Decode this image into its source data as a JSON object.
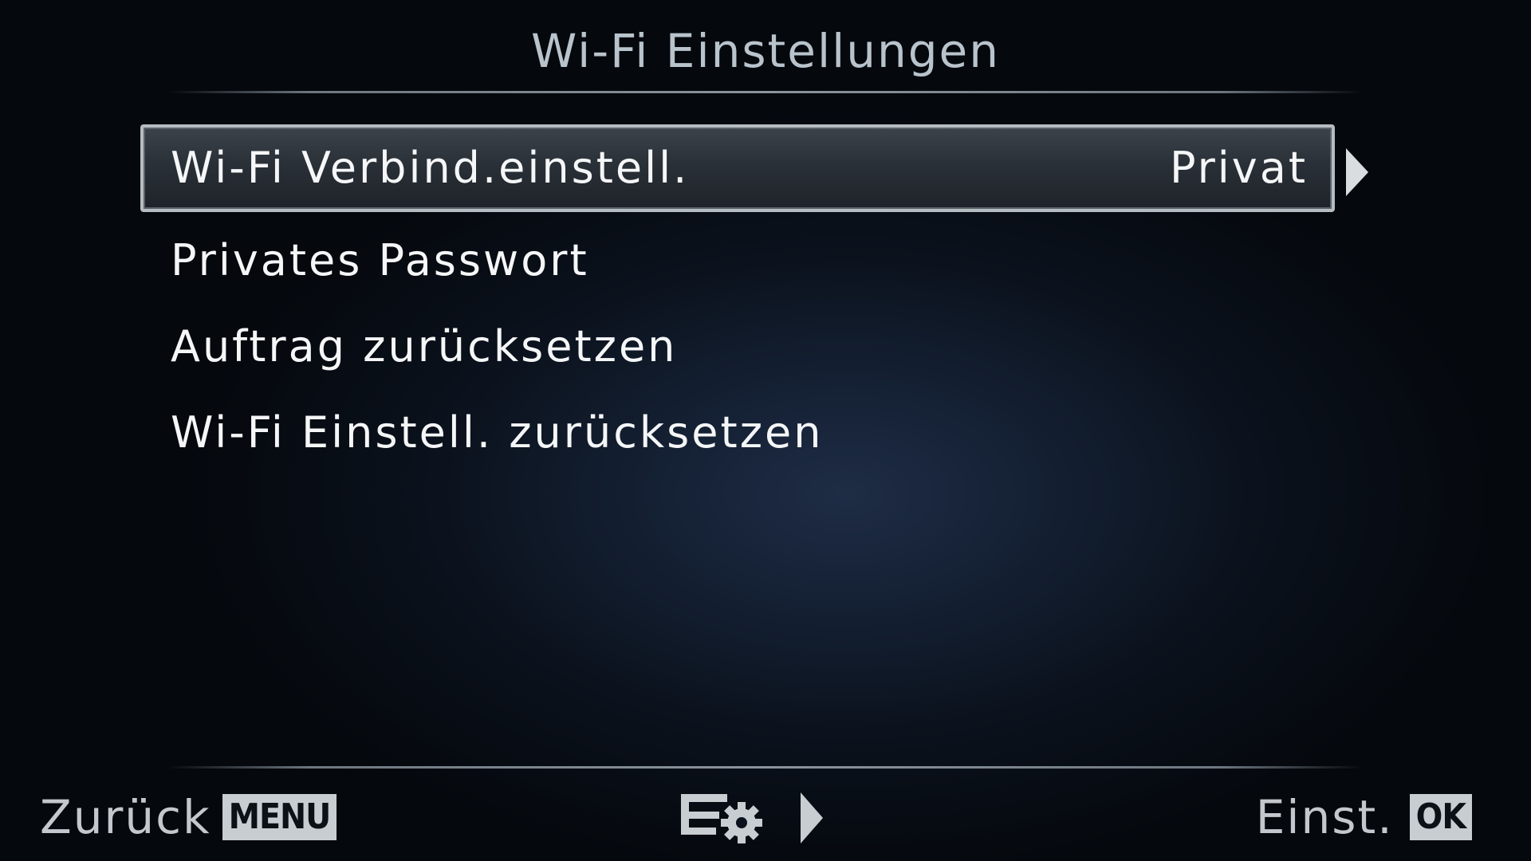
{
  "header": {
    "title": "Wi-Fi Einstellungen"
  },
  "menu": {
    "items": [
      {
        "label": "Wi-Fi Verbind.einstell.",
        "value": "Privat",
        "selected": true
      },
      {
        "label": "Privates Passwort"
      },
      {
        "label": "Auftrag zurücksetzen"
      },
      {
        "label": "Wi-Fi Einstell. zurücksetzen"
      }
    ]
  },
  "footer": {
    "back_label": "Zurück",
    "back_key": "MENU",
    "set_label": "Einst.",
    "set_key": "OK",
    "mid_icon": "settings-list-icon",
    "mid_arrow_icon": "arrow-right-icon"
  },
  "colors": {
    "background": "#05080d",
    "text": "#f2f4f6",
    "title": "#b8c3cc",
    "selection_border": "#b5bcc2",
    "key_badge": "#c8cdd1"
  }
}
